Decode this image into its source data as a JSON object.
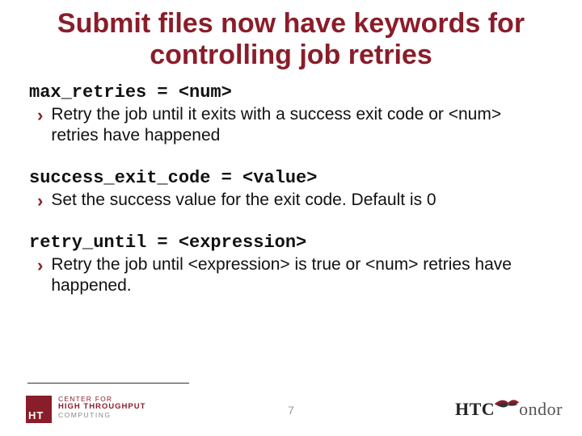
{
  "title": "Submit files now have keywords for controlling job retries",
  "items": [
    {
      "code": "max_retries = <num>",
      "desc": "Retry the job until it exits with a success exit code or <num> retries have happened"
    },
    {
      "code": "success_exit_code = <value>",
      "desc": "Set the success value for the exit code. Default is 0"
    },
    {
      "code": "retry_until = <expression>",
      "desc": "Retry the job until <expression> is true or <num> retries have happened."
    }
  ],
  "footer": {
    "page_number": "7",
    "left_logo": {
      "badge": "HT",
      "line1": "CENTER FOR",
      "line2": "HIGH THROUGHPUT",
      "line3": "COMPUTING"
    },
    "right_logo": {
      "bold": "HTC",
      "light": "ondor"
    }
  }
}
